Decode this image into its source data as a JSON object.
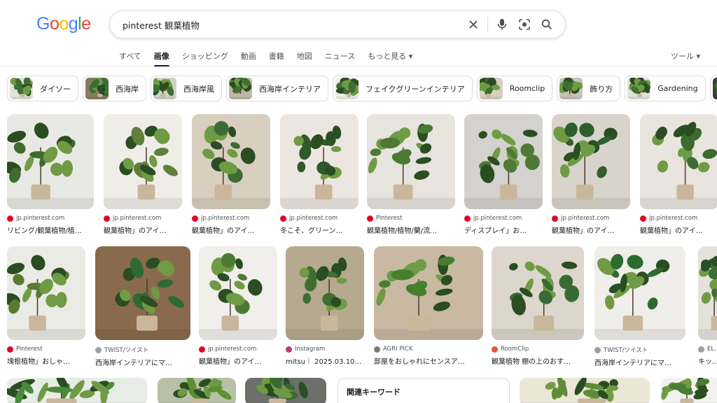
{
  "logo": {
    "letters": [
      "G",
      "o",
      "o",
      "g",
      "l",
      "e"
    ],
    "colors": [
      "#4285F4",
      "#EA4335",
      "#FBBC05",
      "#4285F4",
      "#34A853",
      "#EA4335"
    ]
  },
  "search": {
    "query": "pinterest 観葉植物",
    "icons": [
      "clear-icon",
      "mic-icon",
      "lens-icon",
      "search-icon"
    ]
  },
  "tabs": [
    {
      "label": "すべて",
      "active": false
    },
    {
      "label": "画像",
      "active": true
    },
    {
      "label": "ショッピング",
      "active": false
    },
    {
      "label": "動画",
      "active": false
    },
    {
      "label": "書籍",
      "active": false
    },
    {
      "label": "地図",
      "active": false
    },
    {
      "label": "ニュース",
      "active": false
    },
    {
      "label": "もっと見る ▾",
      "active": false
    }
  ],
  "tools_label": "ツール ▾",
  "chips": [
    {
      "label": "ダイソー",
      "icon": "plant-photo"
    },
    {
      "label": "西海岸",
      "icon": "plant-photo"
    },
    {
      "label": "西海岸風",
      "icon": "plant-photo"
    },
    {
      "label": "西海岸インテリア",
      "icon": "plant-photo"
    },
    {
      "label": "フェイクグリーンインテリア",
      "icon": "plant-photo"
    },
    {
      "label": "Roomclip",
      "icon": "plant-photo"
    },
    {
      "label": "飾り方",
      "icon": "plant-photo"
    },
    {
      "label": "Gardening",
      "icon": "plant-photo"
    },
    {
      "label": "",
      "icon": "plant-photo"
    }
  ],
  "row1": [
    {
      "source": "jp.pinterest.com",
      "title": "リビング/観葉植物/植…",
      "fav": "#e60023",
      "bg": "#e8e9e4",
      "leaf": "#3f6b2f"
    },
    {
      "source": "jp.pinterest.com",
      "title": "観葉植物」のアイ…",
      "fav": "#e60023",
      "bg": "#efede8",
      "leaf": "#5f7f3b"
    },
    {
      "source": "jp.pinterest.com",
      "title": "観葉植物」のアイ…",
      "fav": "#e60023",
      "bg": "#d9cfc0",
      "leaf": "#3e6a35"
    },
    {
      "source": "jp.pinterest.com",
      "title": "冬こそ、グリーン…",
      "fav": "#e60023",
      "bg": "#ebe6df",
      "leaf": "#2f5a2b"
    },
    {
      "source": "Pinterest",
      "title": "観葉植物/植物/蘭/流…",
      "fav": "#e60023",
      "bg": "#e6e4dc",
      "leaf": "#4b7a34"
    },
    {
      "source": "jp.pinterest.com",
      "title": "ディスプレイ」お…",
      "fav": "#e60023",
      "bg": "#d3d2ce",
      "leaf": "#4e7a37"
    },
    {
      "source": "jp.pinterest.com",
      "title": "観葉植物」のアイ…",
      "fav": "#e60023",
      "bg": "#d8d4cc",
      "leaf": "#2e5f2c"
    },
    {
      "source": "jp.pinterest.com",
      "title": "観葉植物」のアイ…",
      "fav": "#e60023",
      "bg": "#e9e5de",
      "leaf": "#3c6b30"
    }
  ],
  "row2": [
    {
      "source": "Pinterest",
      "title": "塊根植物」おしゃ…",
      "fav": "#e60023",
      "bg": "#e9ebe4",
      "leaf": "#5a7a30"
    },
    {
      "source": "TWIST/ツイスト",
      "title": "西海岸インテリアにマ…",
      "fav": "#9aa0a6",
      "bg": "#8a6a4d",
      "leaf": "#2e6a34"
    },
    {
      "source": "jp.pinterest.com",
      "title": "観葉植物」のアイ…",
      "fav": "#e60023",
      "bg": "#f0efec",
      "leaf": "#4a7a33"
    },
    {
      "source": "Instagram",
      "title": "mitsu｜ 2025.03.10…",
      "fav": "#c13584",
      "bg": "#b5a990",
      "leaf": "#3f6e2f"
    },
    {
      "source": "AGRI PICK",
      "title": "部屋をおしゃれにセンスア…",
      "fav": "#7a7a7a",
      "bg": "#c9b9a2",
      "leaf": "#46802f"
    },
    {
      "source": "RoomClip",
      "title": "観葉植物 棚の上のおす…",
      "fav": "#e8552d",
      "bg": "#dcd6cc",
      "leaf": "#3a6a33"
    },
    {
      "source": "TWIST/ツイスト",
      "title": "西海岸インテリアにマ…",
      "fav": "#9aa0a6",
      "bg": "#efeeea",
      "leaf": "#2f6a2f"
    },
    {
      "source": "EL…",
      "title": "キッ…",
      "fav": "#9aa0a6",
      "bg": "#e5e2dc",
      "leaf": "#3f6e33"
    }
  ],
  "row3": [
    {
      "bg": "#e7ece6",
      "leaf": "#4b8a3a"
    },
    {
      "bg": "#b8c0a8",
      "leaf": "#5d8f2f"
    },
    {
      "bg": "#6d6f6a",
      "leaf": "#3a6a30"
    },
    {
      "bg": "#ece6d6",
      "leaf": "#5e8c37"
    },
    {
      "bg": "#f2f1ee",
      "leaf": "#4a7c35"
    }
  ],
  "related_title": "関連キーワード"
}
